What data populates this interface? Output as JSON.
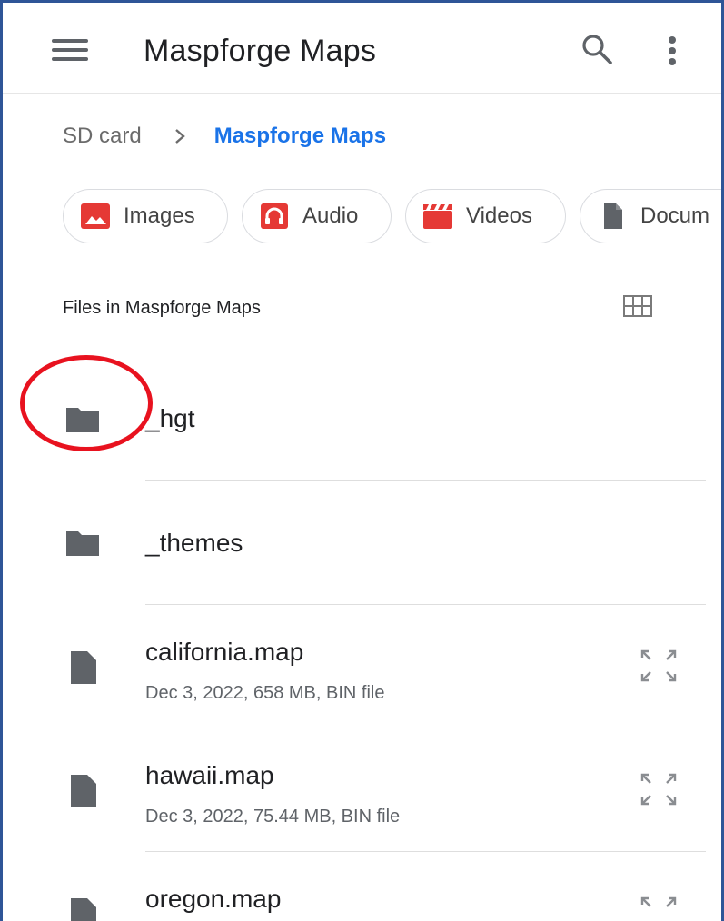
{
  "app": {
    "title": "Maspforge Maps",
    "menu_icon": "hamburger-menu-icon",
    "search_icon": "search-icon",
    "more_icon": "more-vert-icon"
  },
  "breadcrumb": {
    "root": "SD card",
    "current": "Maspforge Maps"
  },
  "chips": [
    {
      "label": "Images",
      "icon": "image-icon",
      "color": "#e53935"
    },
    {
      "label": "Audio",
      "icon": "headphones-icon",
      "color": "#e53935"
    },
    {
      "label": "Videos",
      "icon": "video-clapper-icon",
      "color": "#e53935"
    },
    {
      "label": "Docum",
      "icon": "document-icon",
      "color": "#5f6368"
    }
  ],
  "section": {
    "title": "Files in Maspforge Maps",
    "view_toggle_icon": "grid-view-icon"
  },
  "files": [
    {
      "name": "_hgt",
      "type": "folder",
      "meta": ""
    },
    {
      "name": "_themes",
      "type": "folder",
      "meta": ""
    },
    {
      "name": "california.map",
      "type": "file",
      "meta": "Dec 3, 2022, 658 MB, BIN file"
    },
    {
      "name": "hawaii.map",
      "type": "file",
      "meta": "Dec 3, 2022, 75.44 MB, BIN file"
    },
    {
      "name": "oregon.map",
      "type": "file",
      "meta": ""
    }
  ],
  "annotation": {
    "highlight_color": "#e8121f"
  }
}
